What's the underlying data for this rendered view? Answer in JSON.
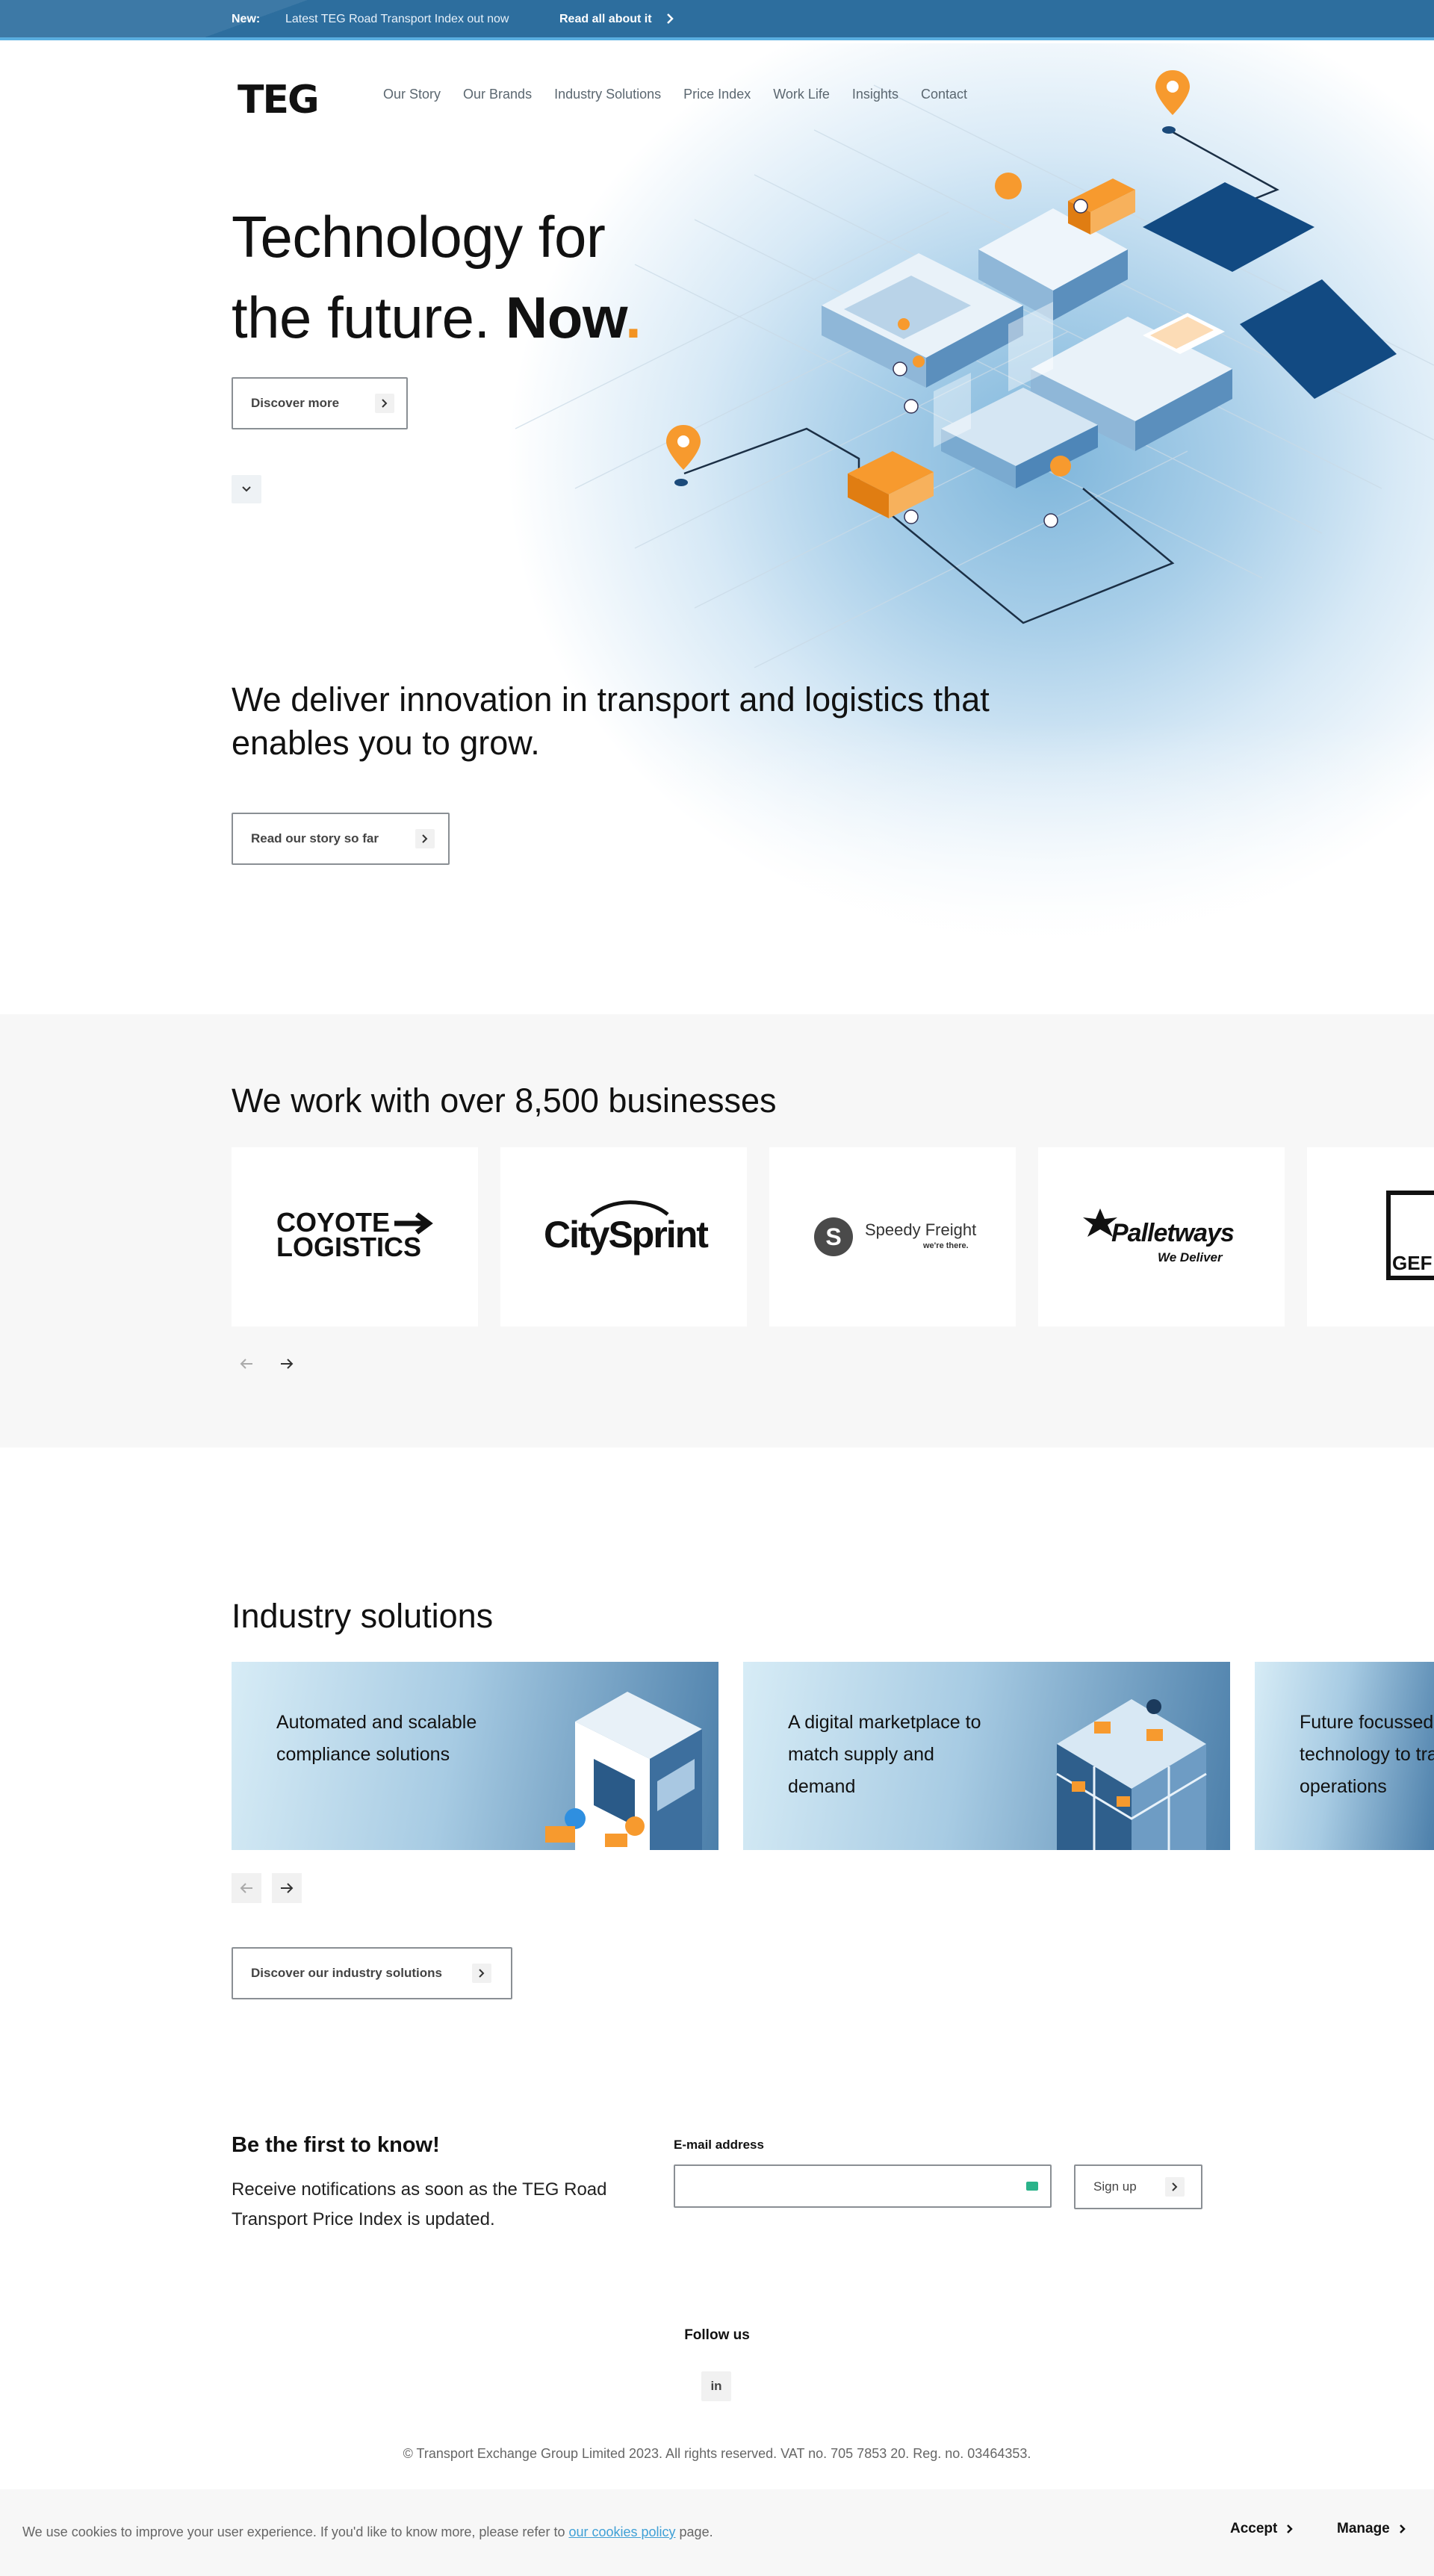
{
  "announcement": {
    "new_label": "New:",
    "message": "Latest TEG Road Transport Index out now",
    "link_label": "Read all about it"
  },
  "header": {
    "logo": "TEG",
    "nav": [
      "Our Story",
      "Our Brands",
      "Industry Solutions",
      "Price Index",
      "Work Life",
      "Insights",
      "Contact"
    ]
  },
  "hero": {
    "headline_line1": "Technology for",
    "headline_line2": "the future. ",
    "headline_emphasis": "Now",
    "headline_dot": ".",
    "discover_label": "Discover more",
    "tagline": "We deliver innovation in transport and logistics that enables you to grow.",
    "story_label": "Read our story so far"
  },
  "partners": {
    "title": "We work with over 8,500 businesses",
    "logos": [
      {
        "line1": "COYOTE",
        "line2": "LOGISTICS"
      },
      {
        "text": "CitySprint"
      },
      {
        "text": "Speedy Freight",
        "sub": "we're there."
      },
      {
        "text": "Palletways",
        "sub": "We Deliver"
      },
      {
        "text": "GEF"
      }
    ]
  },
  "industry": {
    "title": "Industry solutions",
    "cards": [
      "Automated and scalable compliance solutions",
      "A digital marketplace to match supply and demand",
      "Future focussed technology to transform operations"
    ],
    "cta_label": "Discover our industry solutions"
  },
  "newsletter": {
    "title": "Be the first to know!",
    "text": "Receive notifications as soon as the TEG Road Transport Price Index is updated.",
    "email_label": "E-mail address",
    "email_value": "",
    "signup_label": "Sign up"
  },
  "footer": {
    "follow_label": "Follow us",
    "linkedin": "in",
    "copyright": "© Transport Exchange Group Limited 2023. All rights reserved. VAT no. 705 7853 20. Reg. no. 03464353."
  },
  "cookie": {
    "text_before": "We use cookies to improve your user experience. If you'd like to know more, please refer to ",
    "link": "our cookies policy",
    "text_after": " page.",
    "accept_label": "Accept",
    "manage_label": "Manage"
  },
  "colors": {
    "brand_blue": "#2d6e9e",
    "accent_orange": "#f39321",
    "link_blue": "#3fa0d6"
  }
}
